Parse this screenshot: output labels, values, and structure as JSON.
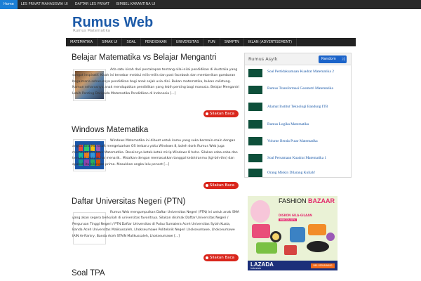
{
  "topbar": {
    "items": [
      "Home",
      "LES PRIVAT MAHASISWA UI",
      "DAFTAR LES PRIVAT",
      "BIMBEL KARANTINA UI"
    ]
  },
  "header": {
    "title": "Rumus Web",
    "description": "Rumus Matematika"
  },
  "nav": {
    "items": [
      "MATEMATIKA",
      "SIMAK UI",
      "SOAL",
      "PENDIDIKAN",
      "UNIVERSITAS",
      "FUN",
      "SNMPTN",
      "IKLAN (ADVERTISEMENT)"
    ]
  },
  "posts": [
    {
      "title": "Belajar Matematika vs Belajar Mengantri",
      "excerpt": "Ada satu kisah dari percakapan tentang nilai-nilai pendidikan di Australia yang sangat inspiratif. Kisah ini tersebar melalui milis-milis dan post facebook dan memberikan gambaran bagaimana seharusnya pendidikan bagi anak sejak usia dini. Bukan matematika, bukan calistung. Namun seharusnya anak mendapatkan pendidikan yang lebih penting bagi manusia. Belajar Mengantri Lebih Penting Daripada Matematika Pendidikan di Indonesia [...]",
      "button": "Silakan Baca"
    },
    {
      "title": "Windows Matematika",
      "excerpt": "Windows Matematika ini dibuat untuk kamu yang suka bermain-main dengan angka. Bila Microsoft mengeluarkan OS terbaru yaitu Windows 8, boleh donk Rumus Web juga membuat Windows Matematika. Desainnya kotak-kotak mirip Windows 8 hehe. Silakan coba-coba dan temukan banyak hal menarik.. Misalkan dengan memasukkan tanggal kelahiranmu (tgl-bln-thn) dan apakah itu bilangan prima. Masukkan angka lalu pencet [...]",
      "button": "Silakan Baca"
    },
    {
      "title": "Daftar Universitas Negeri (PTN)",
      "excerpt": "Rumus Web mengumpulkan Daftar Universitas Negeri (PTN) ini untuk anak SMA yang akan segera berkuliah di universitas favoritnya. Silakan disimak   Daftar Universitas Negeri / Perguruan Tinggi Negeri / PTN Daftar Universitas di Pulau Sumatera Aceh Universitas Syiah Kuala, Banda Aceh Universitas Malikussaleh, Lhokseumawe Politeknik Negeri Lhokseumawe, Lhokseumawe IAIN Ar-Raniry, Banda Aceh STAIN Malikussaleh, Lhokseumawe [...]",
      "button": "Silakan Baca"
    },
    {
      "title": "Soal TPA"
    }
  ],
  "sidebar": {
    "title": "Rumus Asyik",
    "random_button": "Random",
    "items": [
      "Soal Pertidaksamaan Kuadrat Matematika 2",
      "Rumus Transformasi Geometri Matematika",
      "Alamat Institut Teknologi Bandung ITB",
      "Rumus Logika Matematika",
      "Volume Benda Putar Matematika",
      "Soal Persamaan Kuadrat Matematika 1",
      "Orang Miskin Dilarang Kuliah!"
    ]
  },
  "ad": {
    "headline_1": "FASHION",
    "headline_2": "BAZAAR",
    "subline": "DISKON GILA-GILAAN",
    "subline2": "HINGGA 80%",
    "brand": "LAZADA",
    "brand_sub": "Indonesia",
    "cta": "BELI SEKARANG"
  },
  "colors": {
    "accent": "#1c5aa8",
    "button_red": "#d9261c",
    "topbar_active": "#1b7fd6",
    "nav_bg": "#222222",
    "sidebar_thumb": "#0d4f3a"
  }
}
